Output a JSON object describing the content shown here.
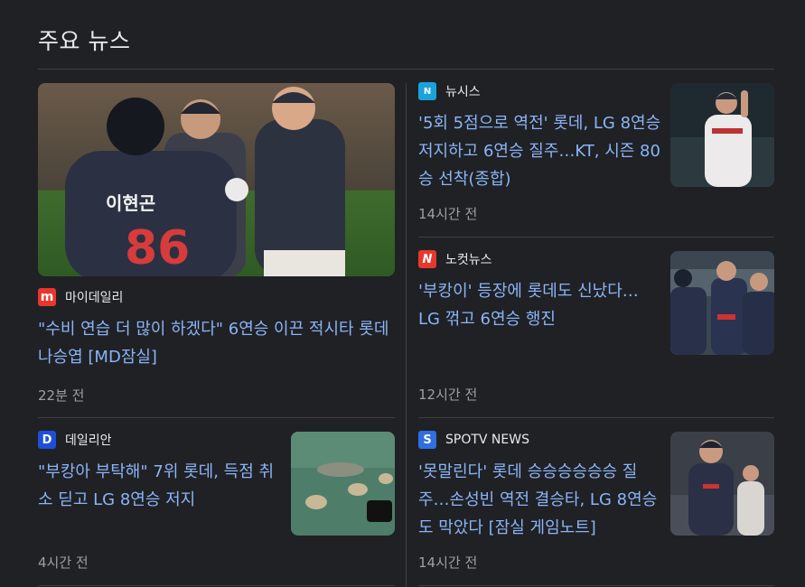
{
  "section_title": "주요 뉴스",
  "articles": [
    {
      "source": "마이데일리",
      "source_logo_letter": "m",
      "source_logo_color": "#e8372c",
      "title": "\"수비 연습 더 많이 하겠다\" 6연승 이끈 적시타 롯데 나승엽 [MD잠실]",
      "time": "22분 전",
      "thumb_jersey_name": "이현곤",
      "thumb_jersey_number": "86"
    },
    {
      "source": "뉴시스",
      "source_logo_letter": "N",
      "source_logo_color": "#1aa3d9",
      "title": "'5회 5점으로 역전' 롯데, LG 8연승 저지하고 6연승 질주…KT, 시즌 80승 선착(종합)",
      "time": "14시간 전"
    },
    {
      "source": "노컷뉴스",
      "source_logo_letter": "N",
      "source_logo_color": "#e8372c",
      "title": "'부캉이' 등장에 롯데도 신났다… LG 꺾고 6연승 행진",
      "time": "12시간 전"
    },
    {
      "source": "데일리안",
      "source_logo_letter": "D",
      "source_logo_color": "#1d4fd8",
      "title": "\"부캉아 부탁해\" 7위 롯데, 득점 취소 딛고 LG 8연승 저지",
      "time": "4시간 전"
    },
    {
      "source": "SPOTV NEWS",
      "source_logo_letter": "S",
      "source_logo_color": "#2f6fe0",
      "title": "'못말린다' 롯데 승승승승승승 질주…손성빈 역전 결승타, LG 8연승도 막았다 [잠실 게임노트]",
      "time": "14시간 전"
    }
  ]
}
